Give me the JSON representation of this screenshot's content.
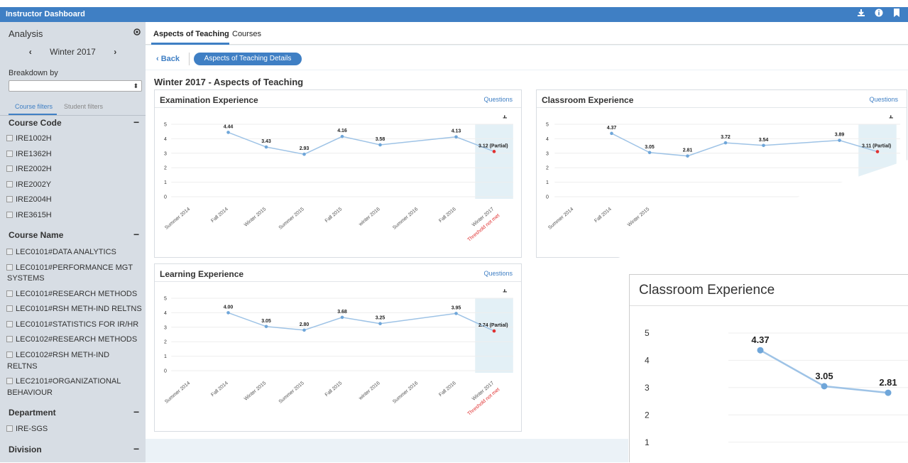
{
  "app": {
    "title": "Instructor Dashboard",
    "icons": [
      "download-icon",
      "info-icon",
      "bookmark-icon"
    ]
  },
  "sidebar": {
    "analysis_label": "Analysis",
    "term_prev": "‹",
    "term": "Winter 2017",
    "term_next": "›",
    "breakdown_label": "Breakdown by",
    "breakdown_value": "",
    "tabs": {
      "course_filters": "Course filters",
      "student_filters": "Student filters"
    },
    "sections": {
      "course_code": {
        "label": "Course Code",
        "toggle": "−",
        "items": [
          "IRE1002H",
          "IRE1362H",
          "IRE2002H",
          "IRE2002Y",
          "IRE2004H",
          "IRE3615H"
        ]
      },
      "course_name": {
        "label": "Course Name",
        "toggle": "−",
        "items": [
          "LEC0101#DATA ANALYTICS",
          "LEC0101#PERFORMANCE MGT",
          "SYSTEMS",
          "LEC0101#RESEARCH METHODS",
          "LEC0101#RSH METH-IND RELTNS",
          "LEC0101#STATISTICS FOR IR/HR",
          "LEC0102#RESEARCH METHODS",
          "LEC0102#RSH METH-IND",
          "RELTNS",
          "LEC2101#ORGANIZATIONAL",
          "BEHAVIOUR"
        ]
      },
      "department": {
        "label": "Department",
        "toggle": "−",
        "items": [
          "IRE-SGS"
        ]
      },
      "division": {
        "label": "Division",
        "toggle": "−"
      }
    }
  },
  "main": {
    "tabs": [
      "Aspects of Teaching",
      "Courses"
    ],
    "back": "‹ Back",
    "breadcrumb_pill": "Aspects of Teaching Details",
    "page_title": "Winter 2017 - Aspects of Teaching",
    "questions_link": "Questions",
    "zoom_title": "Classroom Experience"
  },
  "colors": {
    "accent": "#3f7fc4",
    "line": "#9ec3e6",
    "point": "#6fa6d9",
    "partial_point": "#e03030",
    "threshold_band": "#e3f0f6",
    "threshold_text": "#e03030"
  },
  "chart_data": [
    {
      "type": "line",
      "title": "Examination Experience",
      "categories": [
        "Summer 2014",
        "Fall 2014",
        "Winter 2015",
        "Summer 2015",
        "Fall 2015",
        "winter 2016",
        "Summer 2016",
        "Fall 2016",
        "Winter 2017"
      ],
      "values": [
        null,
        4.44,
        3.43,
        2.93,
        4.16,
        3.58,
        null,
        4.13,
        3.12
      ],
      "labels": [
        "",
        "4.44",
        "3.43",
        "2.93",
        "4.16",
        "3.58",
        "",
        "4.13",
        "3.12 (Partial)"
      ],
      "threshold_note": "Threshold not met",
      "ylim": [
        0,
        5
      ],
      "yticks": [
        0,
        1,
        2,
        3,
        4,
        5
      ]
    },
    {
      "type": "line",
      "title": "Classroom Experience",
      "categories": [
        "Summer 2014",
        "Fall 2014",
        "Winter 2015"
      ],
      "values": [
        null,
        4.37,
        3.05,
        2.81,
        3.72,
        3.54,
        null,
        3.89,
        3.11
      ],
      "labels": [
        "",
        "4.37",
        "3.05",
        "2.81",
        "3.72",
        "3.54",
        "",
        "3.89",
        "3.11 (Partial)"
      ],
      "ylim": [
        0,
        5
      ],
      "yticks": [
        0,
        1,
        2,
        3,
        4,
        5
      ]
    },
    {
      "type": "line",
      "title": "Learning Experience",
      "categories": [
        "Summer 2014",
        "Fall 2014",
        "Winter 2015",
        "Summer 2015",
        "Fall 2015",
        "winter 2016",
        "Summer 2016",
        "Fall 2016",
        "Winter 2017"
      ],
      "values": [
        null,
        4.0,
        3.05,
        2.8,
        3.68,
        3.25,
        null,
        3.95,
        2.74
      ],
      "labels": [
        "",
        "4.00",
        "3.05",
        "2.80",
        "3.68",
        "3.25",
        "",
        "3.95",
        "2.74 (Partial)"
      ],
      "threshold_note": "Threshold not met",
      "ylim": [
        0,
        5
      ],
      "yticks": [
        0,
        1,
        2,
        3,
        4,
        5
      ]
    },
    {
      "type": "line",
      "title": "Classroom Experience",
      "values": [
        4.37,
        3.05,
        2.81
      ],
      "labels": [
        "4.37",
        "3.05",
        "2.81"
      ],
      "ylim": [
        0,
        5
      ],
      "yticks": [
        1,
        2,
        3,
        4,
        5
      ]
    }
  ]
}
